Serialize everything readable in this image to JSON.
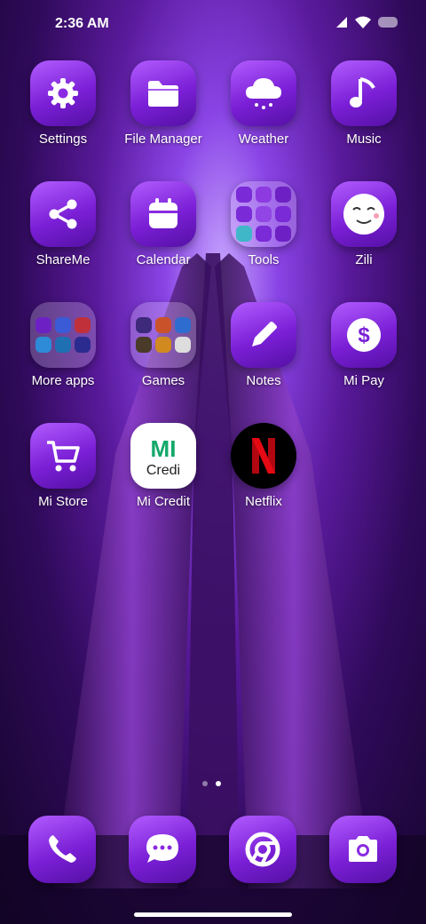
{
  "status_bar": {
    "time": "2:36 AM"
  },
  "apps": [
    {
      "label": "Settings",
      "icon": "gear-icon"
    },
    {
      "label": "File Manager",
      "icon": "folder-icon"
    },
    {
      "label": "Weather",
      "icon": "cloud-rain-icon"
    },
    {
      "label": "Music",
      "icon": "music-note-icon"
    },
    {
      "label": "ShareMe",
      "icon": "share-icon"
    },
    {
      "label": "Calendar",
      "icon": "calendar-icon"
    },
    {
      "label": "Tools",
      "icon": "folder-icon"
    },
    {
      "label": "Zili",
      "icon": "smiley-face-icon"
    },
    {
      "label": "More apps",
      "icon": "folder-icon"
    },
    {
      "label": "Games",
      "icon": "folder-icon"
    },
    {
      "label": "Notes",
      "icon": "pencil-icon"
    },
    {
      "label": "Mi Pay",
      "icon": "dollar-icon"
    },
    {
      "label": "Mi Store",
      "icon": "cart-icon"
    },
    {
      "label": "Mi Credit",
      "icon": "mi-credit-logo-icon"
    },
    {
      "label": "Netflix",
      "icon": "netflix-logo-icon"
    }
  ],
  "dock": [
    {
      "name": "phone",
      "icon": "phone-icon"
    },
    {
      "name": "messages",
      "icon": "message-icon"
    },
    {
      "name": "browser",
      "icon": "chrome-icon"
    },
    {
      "name": "camera",
      "icon": "camera-icon"
    }
  ],
  "page_indicator": {
    "pages": 2,
    "current": 2
  },
  "colors": {
    "accent": "#8a2be2",
    "netflix_red": "#e50914",
    "mi_green": "#14a86b"
  }
}
